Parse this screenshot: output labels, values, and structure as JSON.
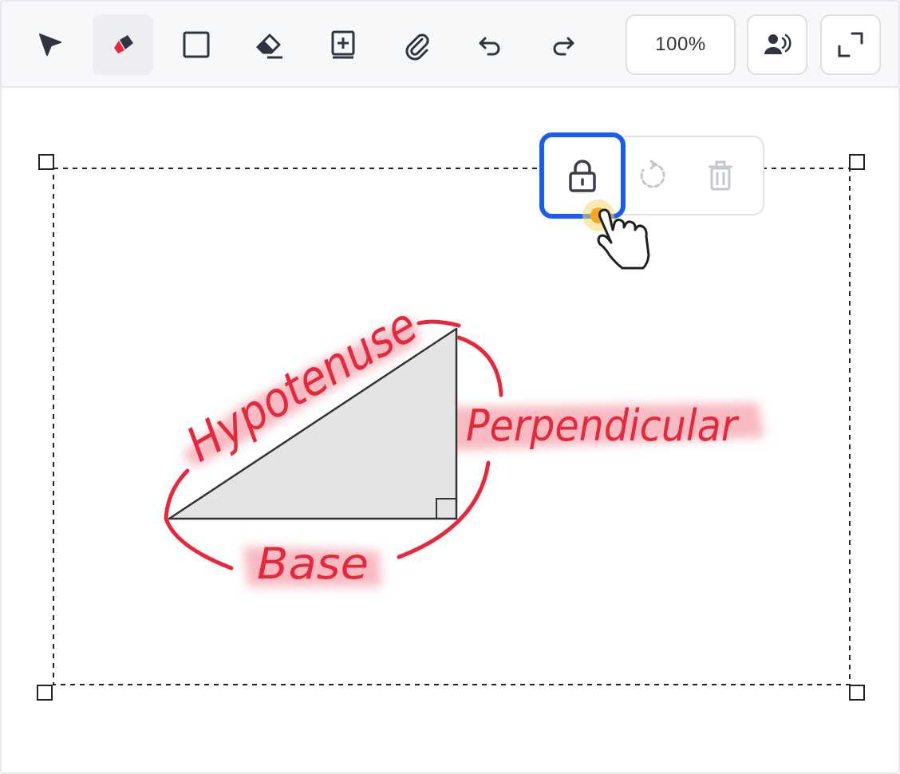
{
  "toolbar": {
    "tools": [
      {
        "name": "select-tool",
        "icon": "cursor-arrow-icon"
      },
      {
        "name": "pen-tool",
        "icon": "marker-pen-icon",
        "active": true
      },
      {
        "name": "rectangle-tool",
        "icon": "square-icon"
      },
      {
        "name": "eraser-tool",
        "icon": "eraser-icon"
      },
      {
        "name": "add-page-tool",
        "icon": "add-page-icon"
      },
      {
        "name": "attach-tool",
        "icon": "paperclip-icon"
      },
      {
        "name": "undo-tool",
        "icon": "undo-icon"
      },
      {
        "name": "redo-tool",
        "icon": "redo-icon"
      }
    ],
    "zoom_label": "100%",
    "present_icon": "presenter-icon",
    "fullscreen_icon": "expand-icon"
  },
  "selection_menu": {
    "lock_icon": "lock-icon",
    "rotate_icon": "rotate-icon",
    "delete_icon": "trash-icon"
  },
  "drawing": {
    "labels": [
      "Hypotenuse",
      "Perpendicular",
      "Base"
    ],
    "accent_color": "#e8273b",
    "highlight_color": "#f6a3ad",
    "triangle_fill": "#e4e4e4"
  },
  "colors": {
    "selection_focus": "#1a5cf0",
    "cursor_highlight": "#f5c518"
  }
}
